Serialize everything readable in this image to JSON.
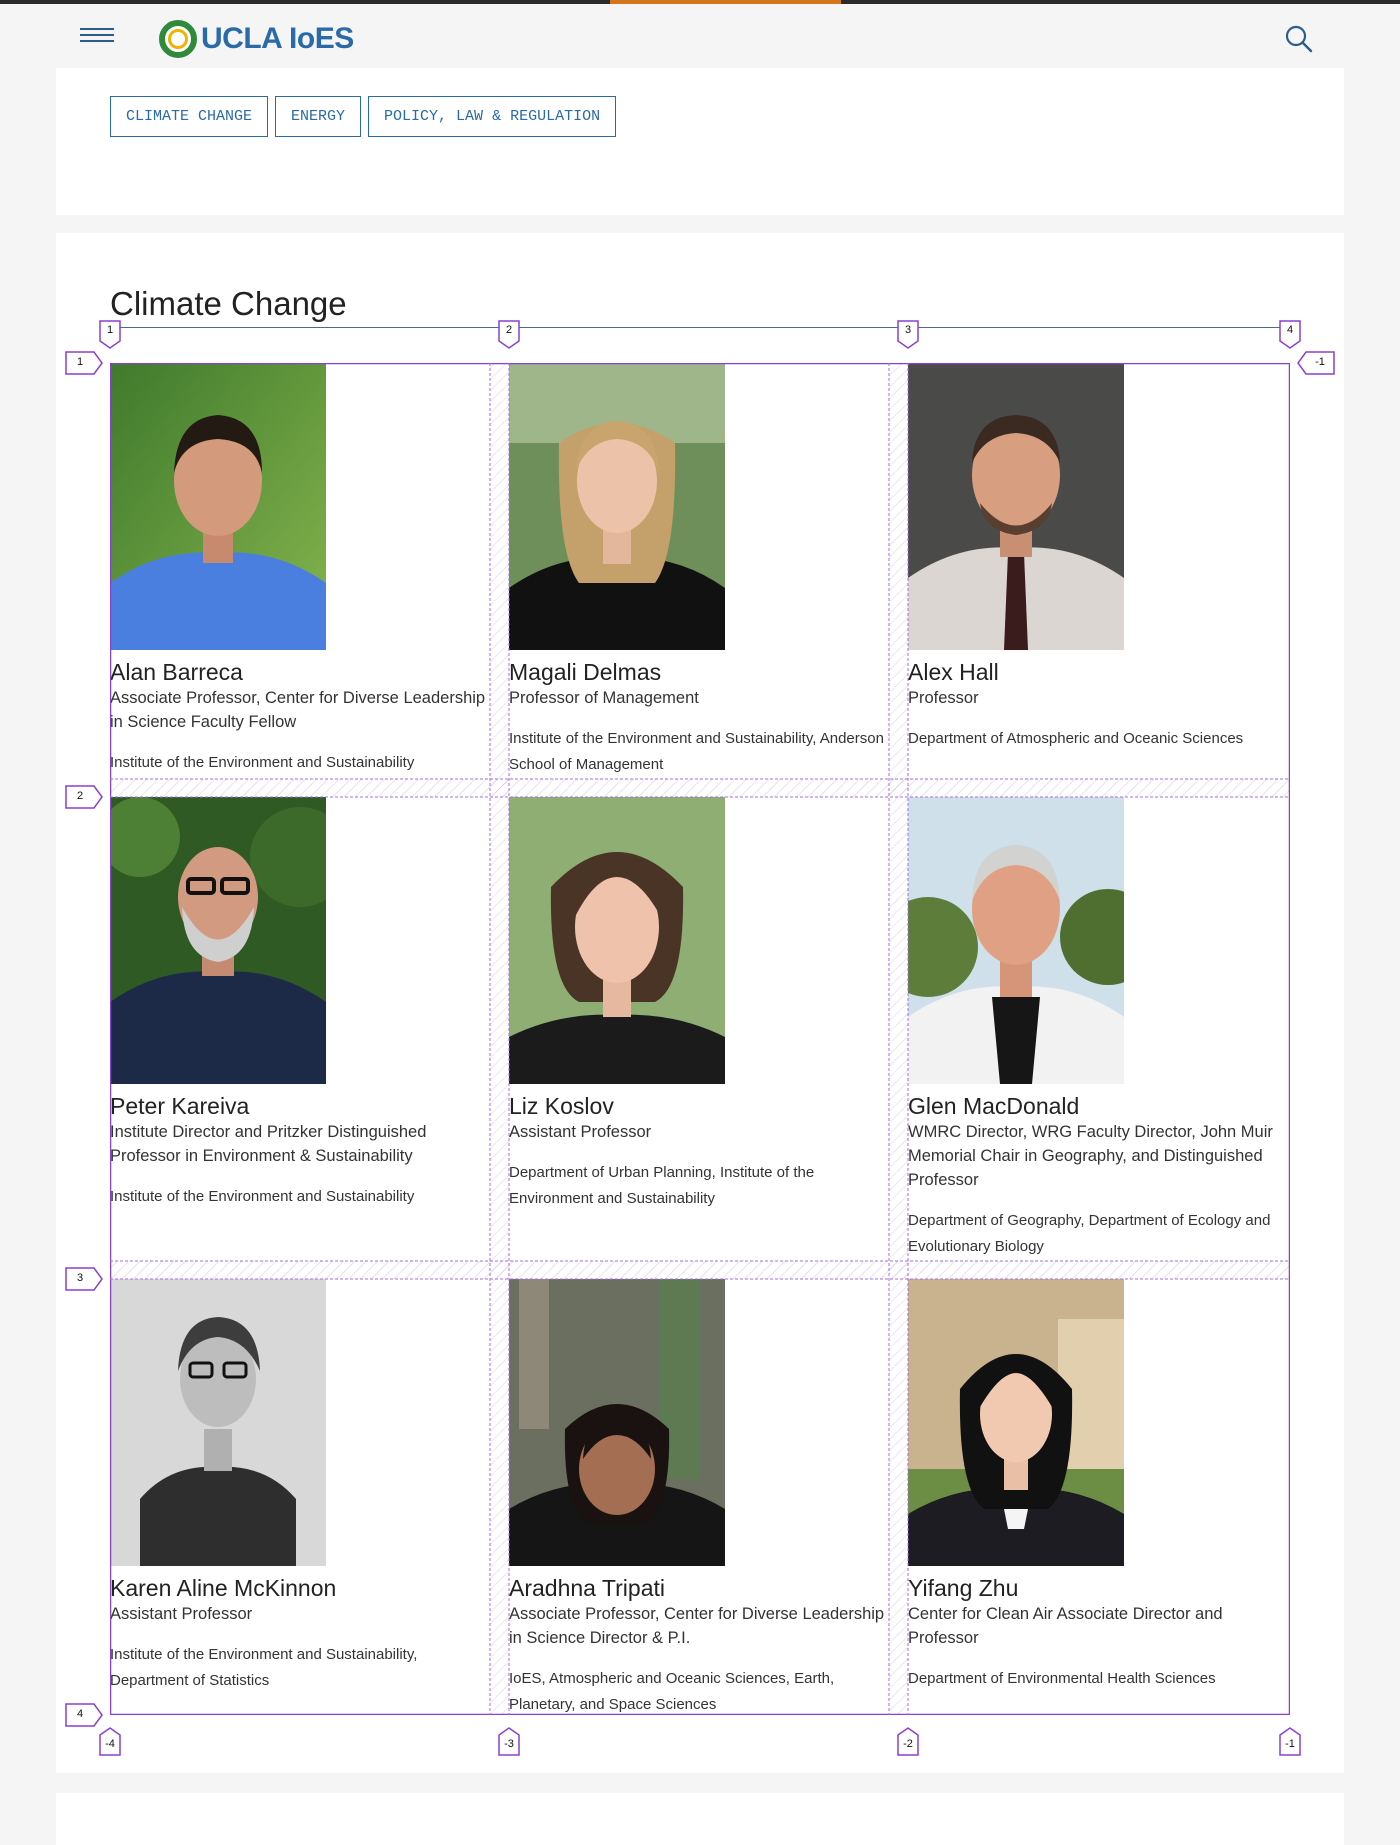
{
  "header": {
    "logo_text": "UCLA IoES",
    "menu_icon": "hamburger-menu-icon",
    "search_icon": "search-icon"
  },
  "tags": [
    {
      "label": "CLIMATE CHANGE"
    },
    {
      "label": "ENERGY"
    },
    {
      "label": "POLICY, LAW & REGULATION"
    }
  ],
  "section": {
    "title": "Climate Change"
  },
  "grid_labels": {
    "cols_top": [
      "1",
      "2",
      "3",
      "4"
    ],
    "cols_bottom": [
      "-4",
      "-3",
      "-2",
      "-1"
    ],
    "rows_left": [
      "1",
      "2",
      "3",
      "4"
    ],
    "rows_right": [
      "-1"
    ]
  },
  "people": [
    {
      "name": "Alan Barreca",
      "title": "Associate Professor, Center for Diverse Leadership in Science Faculty Fellow",
      "dept": "Institute of the Environment and Sustainability"
    },
    {
      "name": "Magali Delmas",
      "title": "Professor of Management",
      "dept": "Institute of the Environment and Sustainability, Anderson School of Management"
    },
    {
      "name": "Alex Hall",
      "title": "Professor",
      "dept": "Department of Atmospheric and Oceanic Sciences"
    },
    {
      "name": "Peter Kareiva",
      "title": "Institute Director and Pritzker Distinguished Professor in Environment & Sustainability",
      "dept": "Institute of the Environment and Sustainability"
    },
    {
      "name": "Liz Koslov",
      "title": "Assistant Professor",
      "dept": "Department of Urban Planning, Institute of the Environment and Sustainability"
    },
    {
      "name": "Glen MacDonald",
      "title": "WMRC Director, WRG Faculty Director, John Muir Memorial Chair in Geography, and Distinguished Professor",
      "dept": "Department of Geography, Department of Ecology and Evolutionary Biology"
    },
    {
      "name": "Karen Aline McKinnon",
      "title": "Assistant Professor",
      "dept": "Institute of the Environment and Sustainability, Department of Statistics"
    },
    {
      "name": "Aradhna Tripati",
      "title": "Associate Professor, Center for Diverse Leadership in Science Director & P.I.",
      "dept": "IoES, Atmospheric and Oceanic Sciences, Earth, Planetary, and Space Sciences"
    },
    {
      "name": "Yifang Zhu",
      "title": "Center for Clean Air Associate Director and Professor",
      "dept": "Department of Environmental Health Sciences"
    }
  ],
  "colors": {
    "accent_bar": "#d4761b",
    "link_blue": "#2a6aa8",
    "grid_overlay": "#8b3fd1"
  }
}
